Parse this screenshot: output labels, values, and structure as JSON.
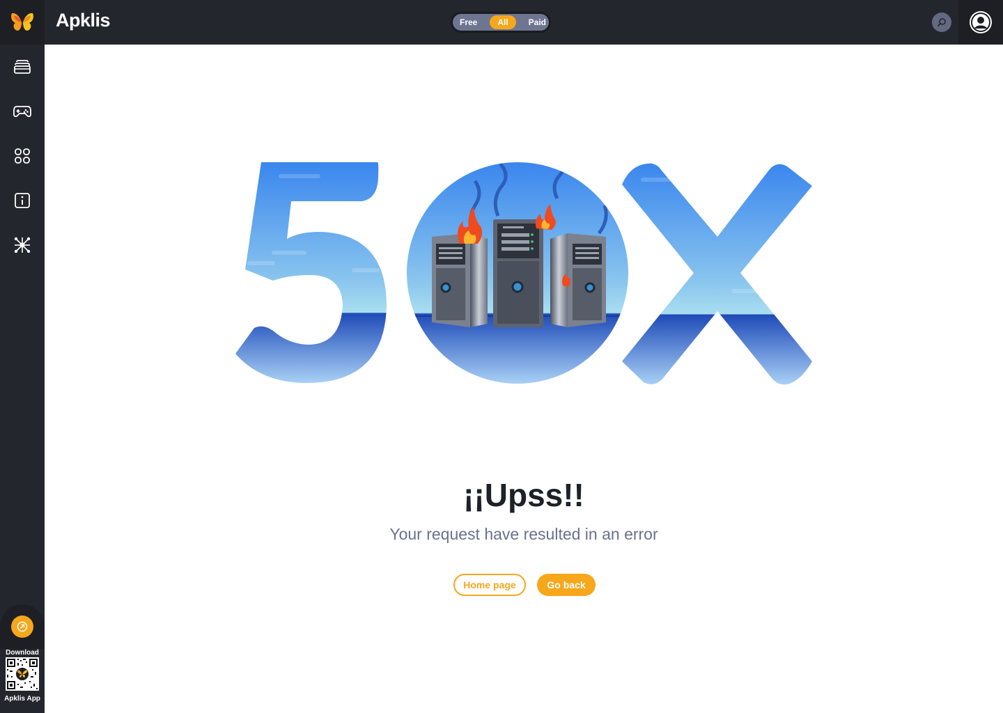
{
  "app": {
    "name": "Apklis"
  },
  "filter": {
    "options": [
      "Free",
      "All",
      "Paid"
    ],
    "selected": "All"
  },
  "sidebar": {
    "items": [
      {
        "name": "apps",
        "icon": "stack-icon"
      },
      {
        "name": "games",
        "icon": "gamepad-icon"
      },
      {
        "name": "categories",
        "icon": "grid-icon"
      },
      {
        "name": "info",
        "icon": "info-icon"
      },
      {
        "name": "network",
        "icon": "network-icon"
      }
    ],
    "download_label": "Download",
    "app_label": "Apklis App"
  },
  "error": {
    "code": "50X",
    "title": "¡¡Upss!!",
    "message": "Your request have resulted in an error",
    "home_button": "Home page",
    "back_button": "Go back"
  },
  "colors": {
    "accent": "#f6a71c",
    "dark": "#24262d",
    "sky": "#3a86ee",
    "sea": "#1f4bb8"
  }
}
